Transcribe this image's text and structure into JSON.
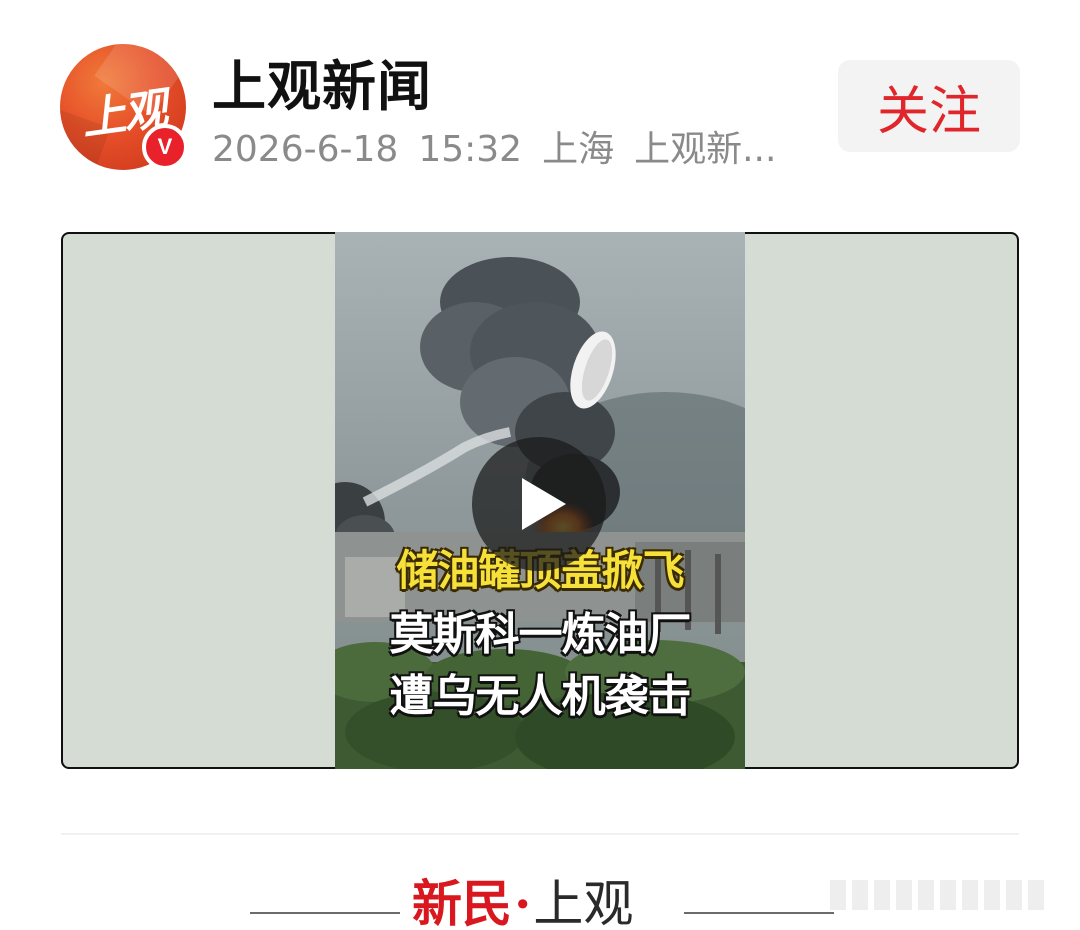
{
  "header": {
    "avatar_text": "上观",
    "verified_badge": "V",
    "account_name": "上观新闻",
    "date": "2026-6-18",
    "time": "15:32",
    "location": "上海",
    "source": "上观新...",
    "follow_label": "关注"
  },
  "video": {
    "caption_line1": "储油罐顶盖掀飞",
    "caption_line2": "莫斯科一炼油厂",
    "caption_line3": "遭乌无人机袭击",
    "play_icon": "play-icon"
  },
  "banner": {
    "brand_left": "新民",
    "brand_dot": "·",
    "brand_right": "上观"
  },
  "colors": {
    "accent_red": "#e0262b",
    "avatar_orange": "#e64f28",
    "meta_gray": "#8a8a8a",
    "video_bg": "#d4dcd3",
    "caption_yellow": "#f6e03a"
  }
}
